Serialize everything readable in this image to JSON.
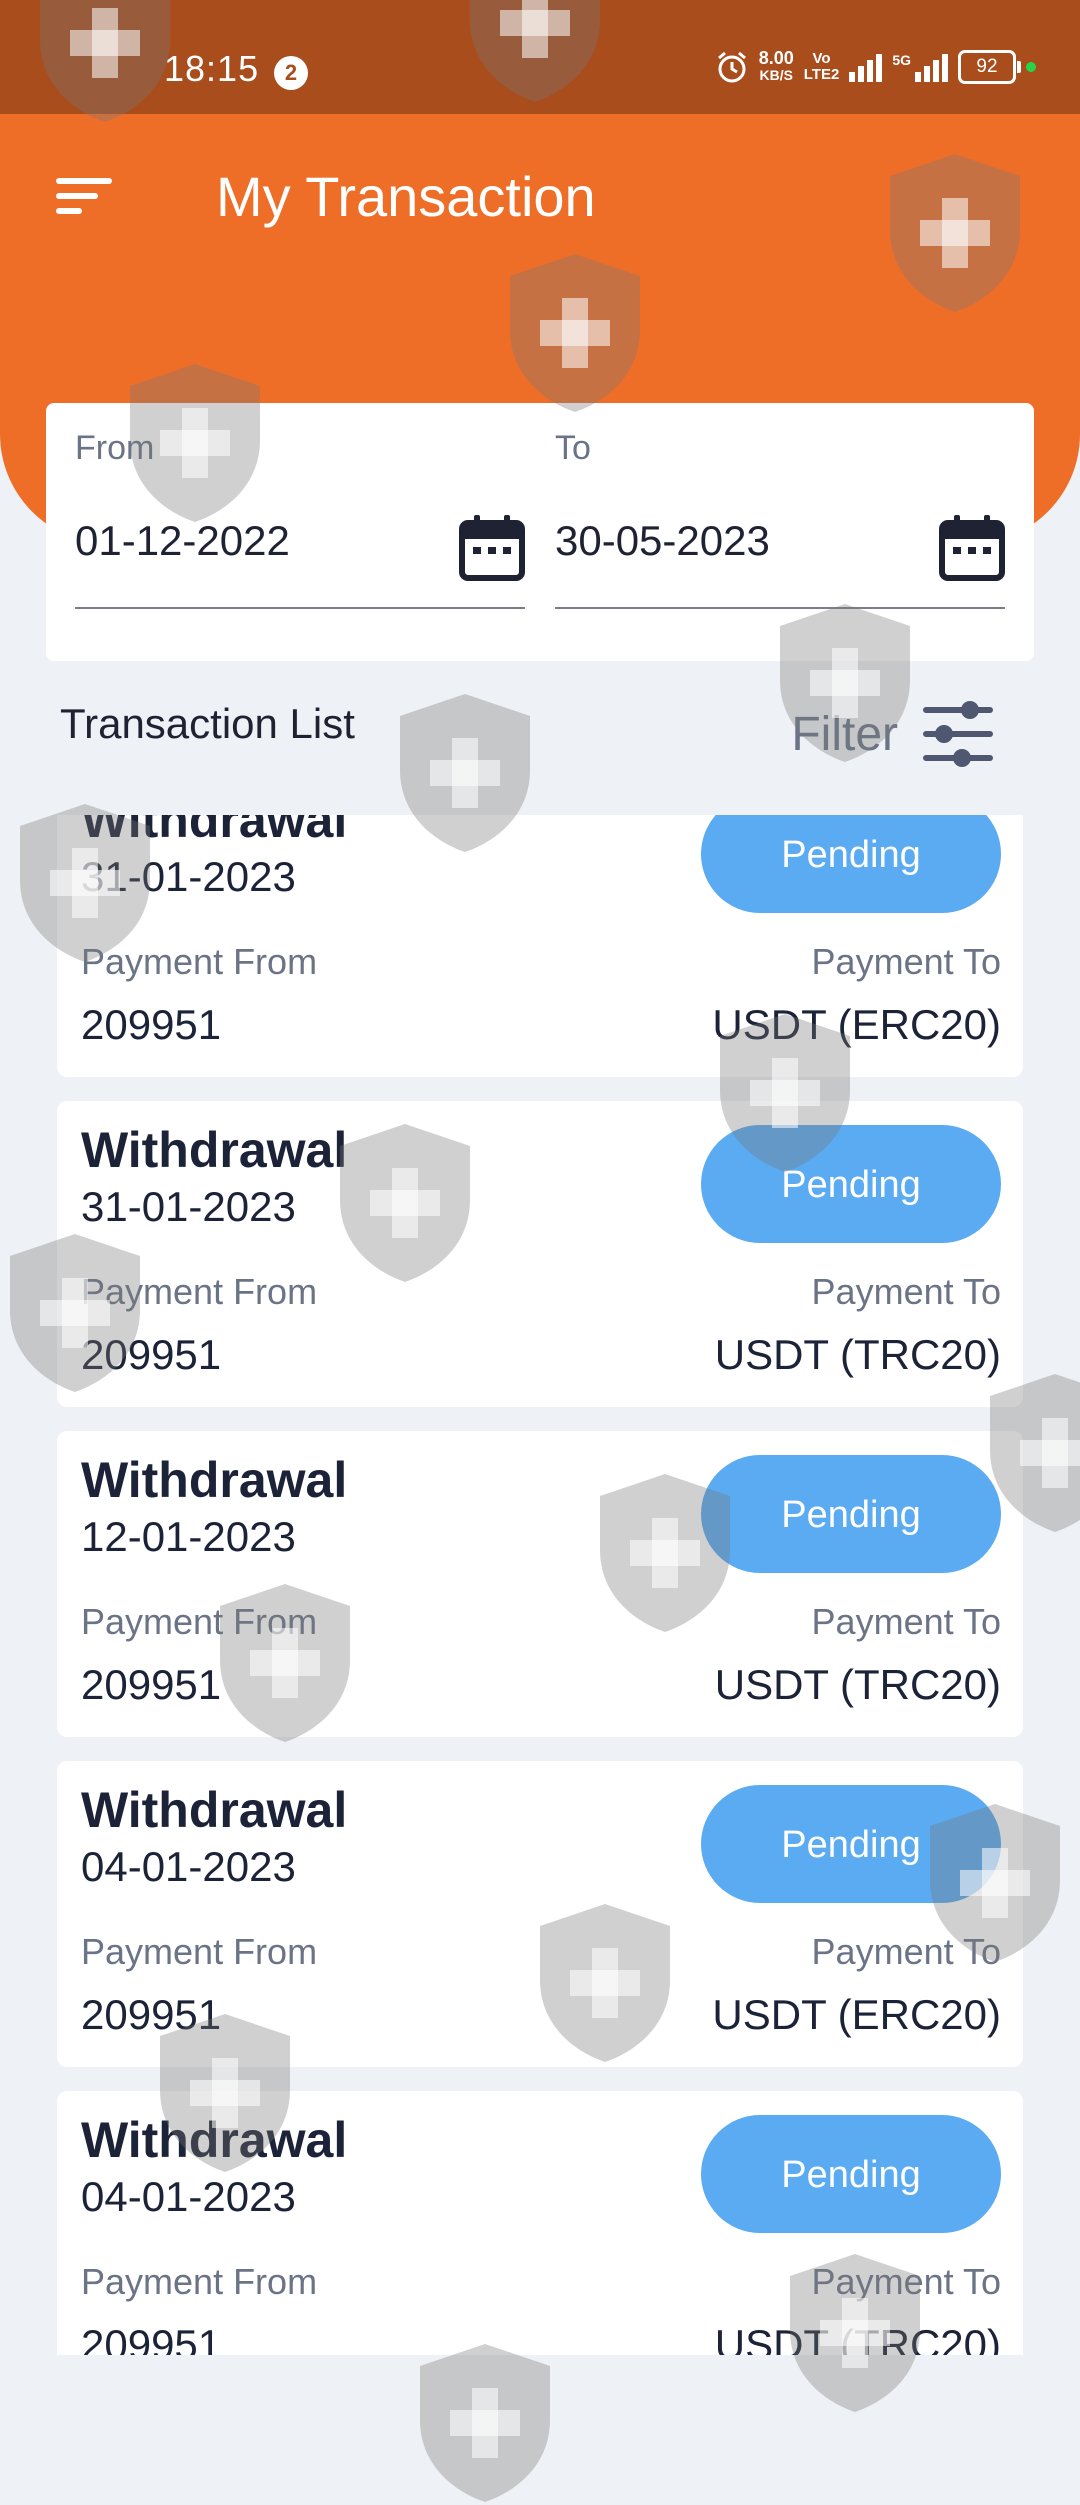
{
  "status_bar": {
    "time": "18:15",
    "notification_count": "2",
    "net_speed_value": "8.00",
    "net_speed_unit": "KB/S",
    "volte_top": "Vo",
    "volte_bottom": "LTE2",
    "network_type": "5G",
    "battery_level": "92"
  },
  "header": {
    "title": "My Transaction"
  },
  "date_range": {
    "from_label": "From",
    "from_value": "01-12-2022",
    "to_label": "To",
    "to_value": "30-05-2023"
  },
  "list": {
    "title": "Transaction List",
    "filter_label": "Filter",
    "payment_from_label": "Payment From",
    "payment_to_label": "Payment To",
    "transactions": [
      {
        "type": "Withdrawal",
        "date": "31-01-2023",
        "status": "Pending",
        "payment_from": "209951",
        "payment_to": "USDT (ERC20)"
      },
      {
        "type": "Withdrawal",
        "date": "31-01-2023",
        "status": "Pending",
        "payment_from": "209951",
        "payment_to": "USDT (TRC20)"
      },
      {
        "type": "Withdrawal",
        "date": "12-01-2023",
        "status": "Pending",
        "payment_from": "209951",
        "payment_to": "USDT (TRC20)"
      },
      {
        "type": "Withdrawal",
        "date": "04-01-2023",
        "status": "Pending",
        "payment_from": "209951",
        "payment_to": "USDT (ERC20)"
      },
      {
        "type": "Withdrawal",
        "date": "04-01-2023",
        "status": "Pending",
        "payment_from": "209951",
        "payment_to": "USDT (TRC20)"
      }
    ]
  },
  "colors": {
    "status_bar_bg": "#a94d1d",
    "header_bg": "#ef6e27",
    "page_bg": "#eef1f5",
    "pill_bg": "#5aabf2",
    "text_dark": "#1c2237",
    "text_muted": "#6b7386"
  },
  "icons": {
    "menu": "menu-icon",
    "calendar": "calendar-icon",
    "filter": "filter-sliders-icon",
    "watermark": "shield-plus-icon"
  }
}
